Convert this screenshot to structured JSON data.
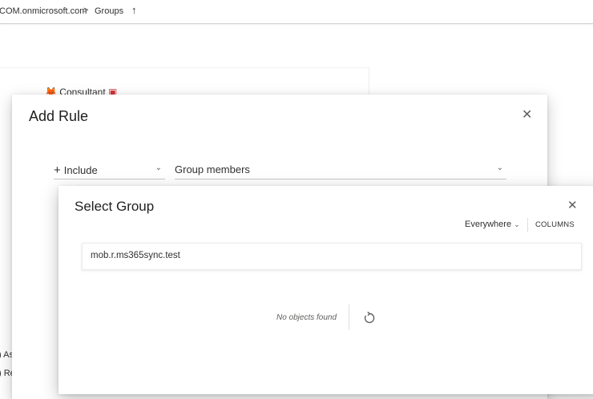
{
  "breadcrumb": {
    "tenant": "COM.onmicrosoft.com",
    "separator": ">",
    "current": "Groups"
  },
  "background": {
    "consultant_label": "Consultant",
    "left_truncated_1": "As",
    "left_truncated_2": "Re"
  },
  "add_rule": {
    "title": "Add Rule",
    "include_dropdown": "Include",
    "include_prefix": "+",
    "target_dropdown": "Group members"
  },
  "select_group": {
    "title": "Select Group",
    "scope_label": "Everywhere",
    "columns_label": "COLUMNS",
    "search_value": "mob.r.ms365sync.test",
    "empty_message": "No objects found"
  },
  "icons": {
    "close": "close-icon",
    "chevron": "chevron-down-icon",
    "refresh": "refresh-icon",
    "sort": "arrow-up-icon"
  },
  "colors": {
    "text_primary": "#323130",
    "text_secondary": "#605e5c",
    "divider": "#c8c6c4"
  }
}
